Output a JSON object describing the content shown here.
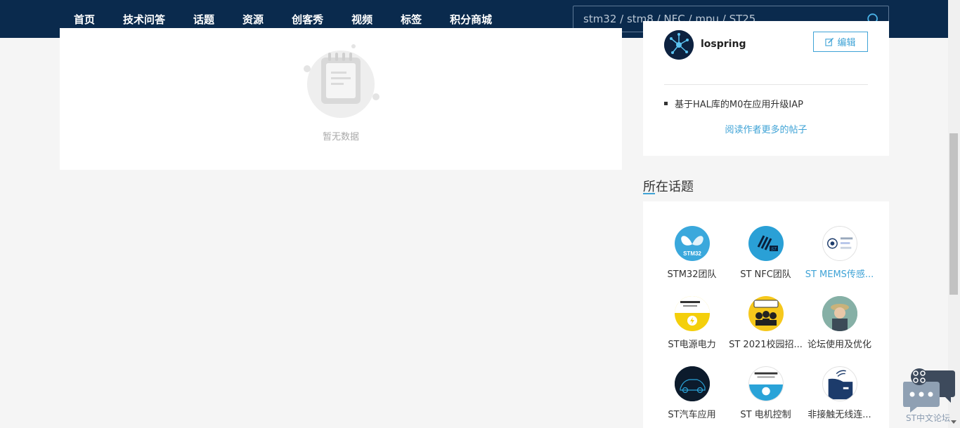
{
  "nav": {
    "items": [
      "首页",
      "技术问答",
      "话题",
      "资源",
      "创客秀",
      "视频",
      "标签",
      "积分商城"
    ]
  },
  "search": {
    "placeholder": "stm32 / stm8 / NFC / mpu / ST25",
    "icon": "search-icon"
  },
  "main": {
    "empty_text": "暂无数据"
  },
  "author": {
    "name": "lospring",
    "edit_label": "编辑",
    "posts": [
      "基于HAL库的M0在应用升级IAP"
    ],
    "more_link": "阅读作者更多的帖子"
  },
  "topics": {
    "title": "所在话题",
    "items": [
      {
        "label": "STM32团队",
        "active": false
      },
      {
        "label": "ST NFC团队",
        "active": false
      },
      {
        "label": "ST MEMS传感...",
        "active": true
      },
      {
        "label": "ST电源电力",
        "active": false
      },
      {
        "label": "ST 2021校园招...",
        "active": false
      },
      {
        "label": "论坛使用及优化",
        "active": false
      },
      {
        "label": "ST汽车应用",
        "active": false
      },
      {
        "label": "ST 电机控制",
        "active": false
      },
      {
        "label": "非接触无线连...",
        "active": false
      }
    ]
  },
  "chat_widget": {
    "label": "ST中文论坛"
  },
  "colors": {
    "nav_bg": "#0a2a4d",
    "accent": "#3fa3d6"
  }
}
